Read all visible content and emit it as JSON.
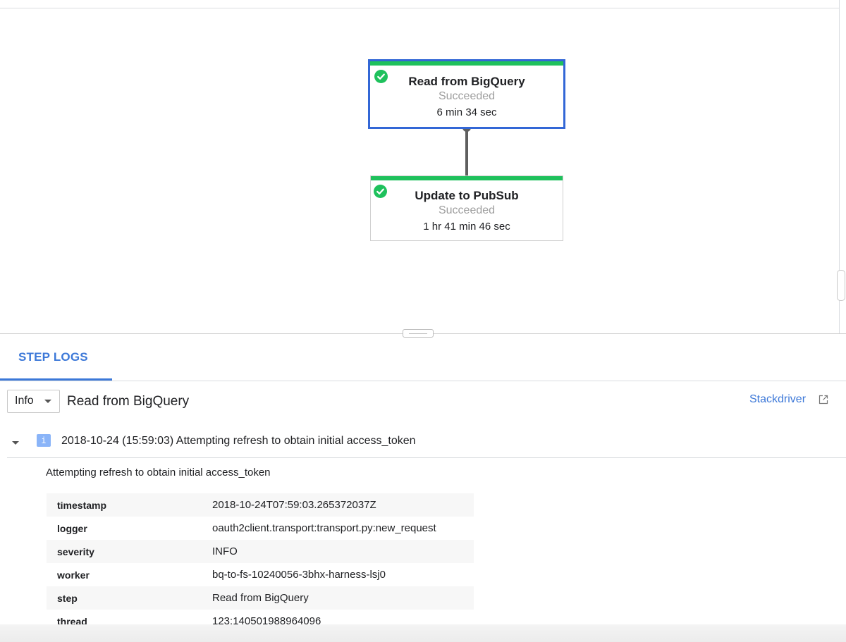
{
  "graph": {
    "nodes": [
      {
        "name": "Read from BigQuery",
        "status": "Succeeded",
        "duration": "6 min 34 sec",
        "selected": true
      },
      {
        "name": "Update to PubSub",
        "status": "Succeeded",
        "duration": "1 hr 41 min 46 sec",
        "selected": false
      }
    ],
    "colors": {
      "success": "#1ec15c",
      "selected_border": "#3367d6"
    }
  },
  "tabs": {
    "step_logs": "STEP LOGS"
  },
  "toolbar": {
    "severity": "Info",
    "step_name": "Read from BigQuery",
    "stackdriver": "Stackdriver"
  },
  "log_entry": {
    "badge": "i",
    "summary": "2018-10-24 (15:59:03) Attempting refresh to obtain initial access_token",
    "message": "Attempting refresh to obtain initial access_token",
    "fields": [
      {
        "key": "timestamp",
        "value": "2018-10-24T07:59:03.265372037Z"
      },
      {
        "key": "logger",
        "value": "oauth2client.transport:transport.py:new_request"
      },
      {
        "key": "severity",
        "value": "INFO"
      },
      {
        "key": "worker",
        "value": "bq-to-fs-10240056-3bhx-harness-lsj0"
      },
      {
        "key": "step",
        "value": "Read from BigQuery"
      },
      {
        "key": "thread",
        "value": "123:140501988964096"
      }
    ]
  },
  "colors": {
    "accent": "#3c78d8"
  }
}
